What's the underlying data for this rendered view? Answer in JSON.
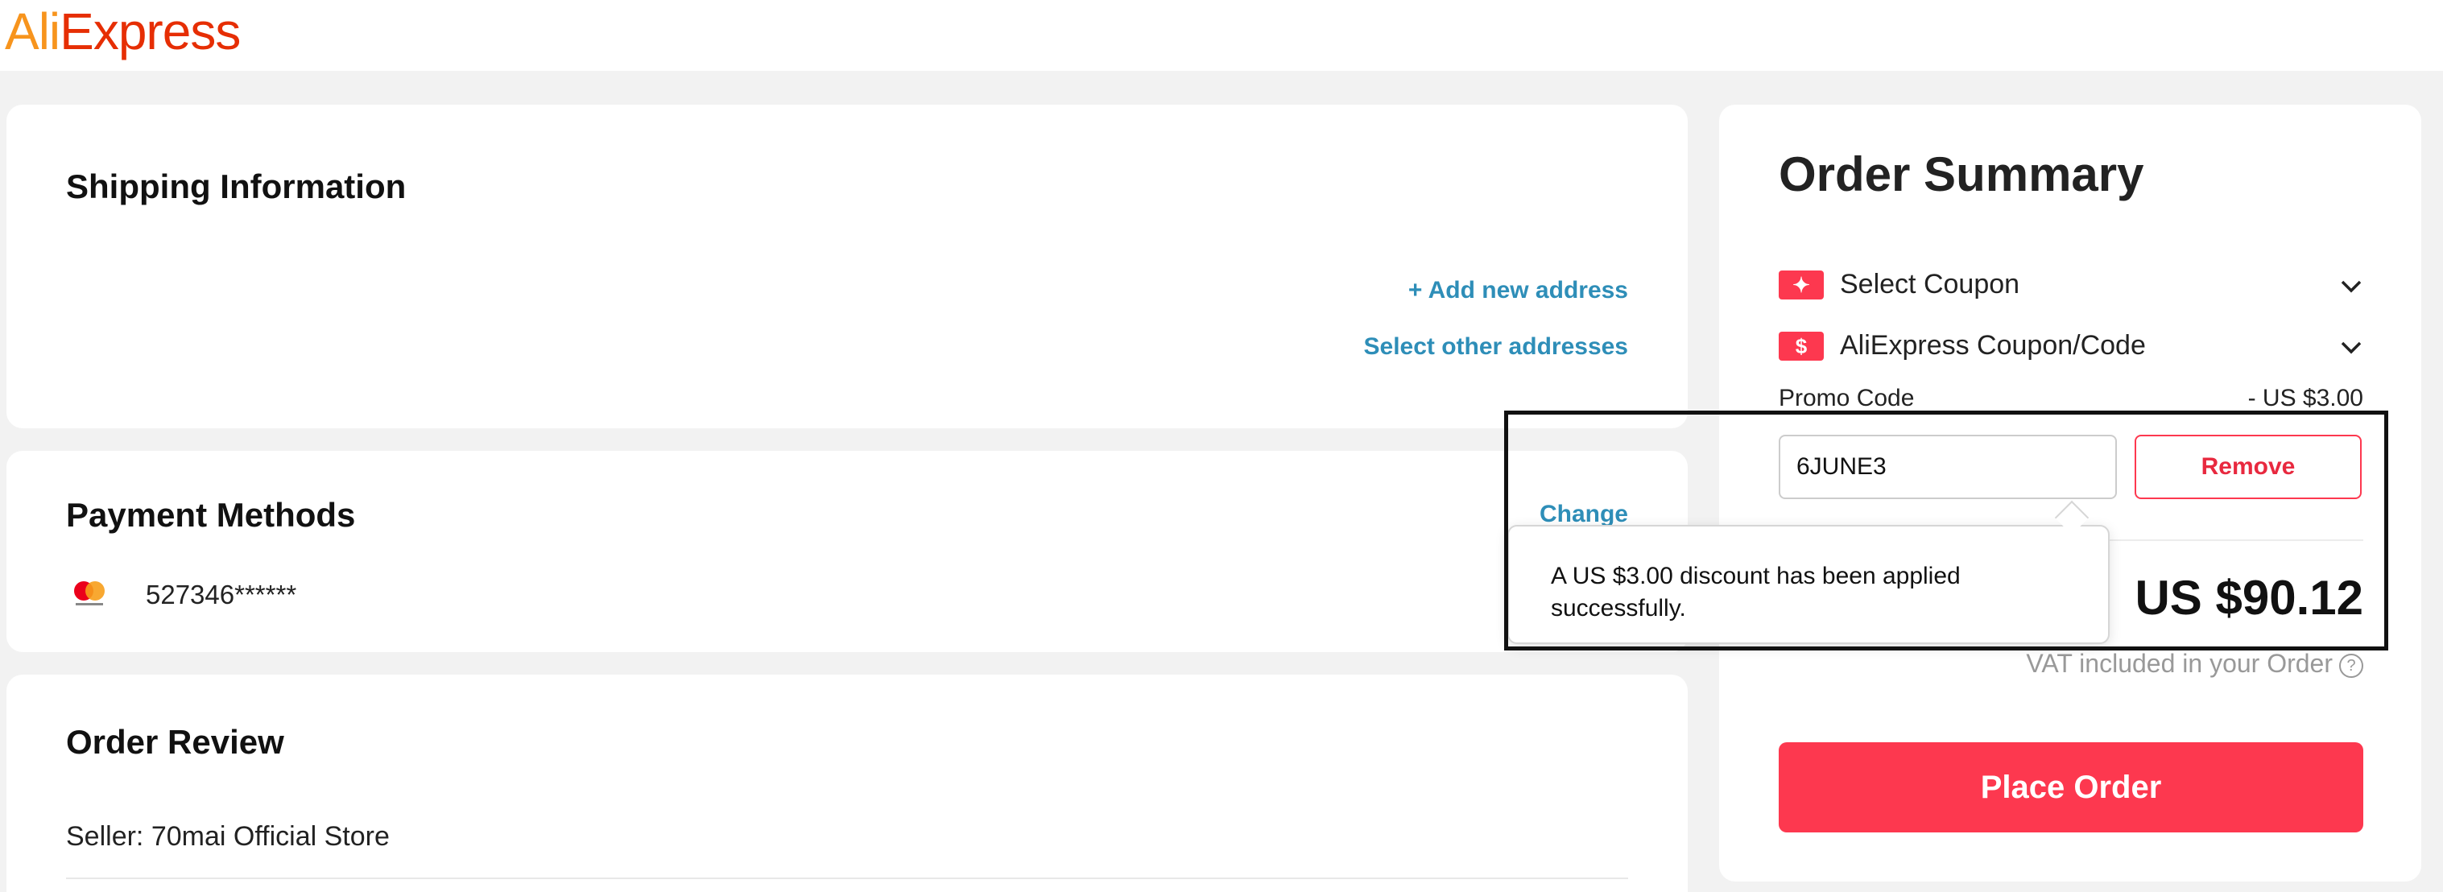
{
  "header": {
    "logo_part1": "Ali",
    "logo_part2": "Express"
  },
  "shipping": {
    "title": "Shipping Information",
    "add_address": "+ Add new address",
    "select_other": "Select other addresses"
  },
  "payment": {
    "title": "Payment Methods",
    "change": "Change",
    "card_number": "527346******",
    "card_icon": "mastercard-icon"
  },
  "review": {
    "title": "Order Review",
    "seller": "Seller: 70mai Official Store"
  },
  "summary": {
    "title": "Order Summary",
    "select_coupon": "Select Coupon",
    "aliexpress_coupon": "AliExpress Coupon/Code",
    "promo_label": "Promo Code",
    "promo_value": "- US $3.00",
    "promo_input_value": "6JUNE3",
    "remove_label": "Remove",
    "total": "US $90.12",
    "vat_text": "VAT included in your Order",
    "place_order": "Place Order",
    "tooltip_text": "A US $3.00 discount has been applied successfully."
  },
  "colors": {
    "accent": "#fd384f",
    "link": "#2e8eb8",
    "logo_orange": "#f7941d",
    "logo_red": "#e62e04"
  }
}
